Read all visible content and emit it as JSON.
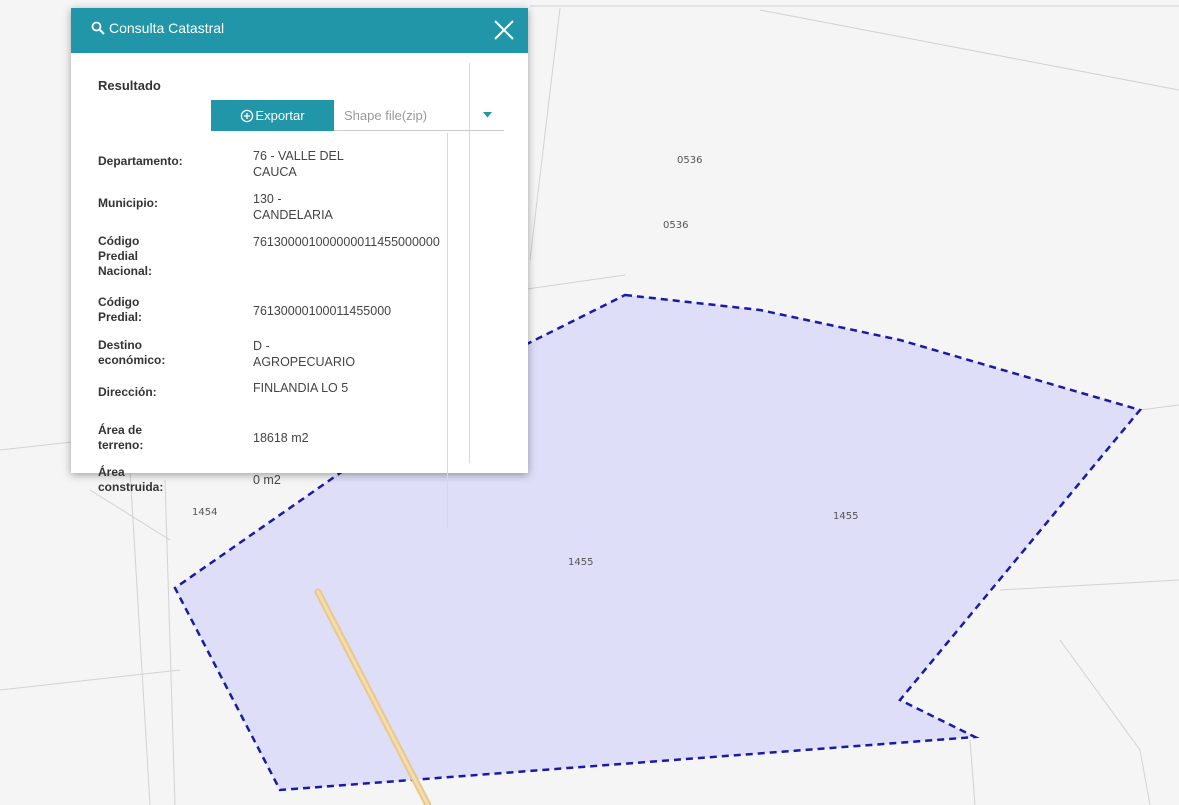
{
  "map": {
    "parcel_labels": [
      "0536",
      "0536",
      "1454",
      "1455",
      "1455"
    ],
    "colors": {
      "parcel_fill": "#dcdcf8",
      "parcel_stroke": "#1a1aa8",
      "road": "#e8c98a"
    }
  },
  "panel": {
    "title": "Consulta Catastral",
    "title_icon": "search-icon",
    "close_icon": "close-icon",
    "header_color": "#2196a8",
    "result_heading": "Resultado",
    "export": {
      "button_label": "Exportar",
      "button_icon": "plus-circle-icon",
      "format_value": "Shape file(zip)"
    },
    "details": [
      {
        "label": "Departamento:",
        "value": "76 - VALLE DEL CAUCA"
      },
      {
        "label": "Municipio:",
        "value": "130 - CANDELARIA"
      },
      {
        "label": "Código Predial Nacional:",
        "value": "761300001000000011455000000"
      },
      {
        "label": "Código Predial:",
        "value": "76130000100011455000"
      },
      {
        "label": "Destino económico:",
        "value": "D - AGROPECUARIO"
      },
      {
        "label": "Dirección:",
        "value": "FINLANDIA LO 5"
      },
      {
        "label": "Área de terreno:",
        "value": "18618 m2"
      },
      {
        "label": "Área construida:",
        "value": "0 m2"
      }
    ]
  }
}
